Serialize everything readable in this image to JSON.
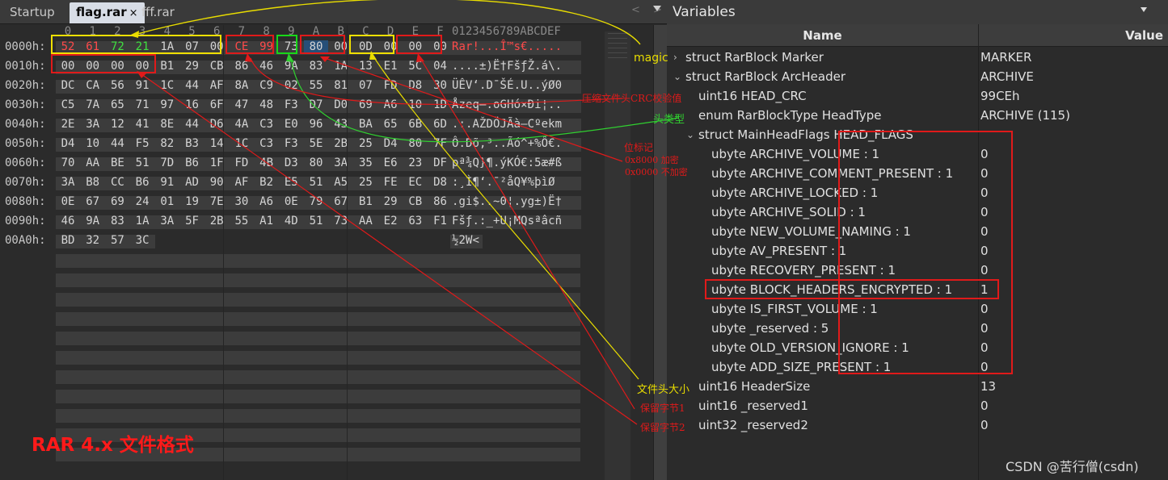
{
  "tabs": [
    {
      "label": "Startup"
    },
    {
      "label": "flag.rar",
      "close": "×"
    },
    {
      "label": "fff.rar"
    }
  ],
  "tab_nav": "< >",
  "hex": {
    "col_headers": [
      "0",
      "1",
      "2",
      "3",
      "4",
      "5",
      "6",
      "7",
      "8",
      "9",
      "A",
      "B",
      "C",
      "D",
      "E",
      "F"
    ],
    "ascii_header": "0123456789ABCDEF",
    "rows": [
      {
        "offset": "0000h:",
        "bytes": [
          "52",
          "61",
          "72",
          "21",
          "1A",
          "07",
          "00",
          "CE",
          "99",
          "73",
          "80",
          "00",
          "0D",
          "00",
          "00",
          "00"
        ],
        "ascii": "Rar!...Î™s€....."
      },
      {
        "offset": "0010h:",
        "bytes": [
          "00",
          "00",
          "00",
          "00",
          "B1",
          "29",
          "CB",
          "86",
          "46",
          "9A",
          "83",
          "1A",
          "13",
          "E1",
          "5C",
          "04"
        ],
        "ascii": "....±)Ë†FšƒŽ.á\\."
      },
      {
        "offset": "0020h:",
        "bytes": [
          "DC",
          "CA",
          "56",
          "91",
          "1C",
          "44",
          "AF",
          "8A",
          "C9",
          "02",
          "55",
          "81",
          "07",
          "FD",
          "D8",
          "30"
        ],
        "ascii": "ÜÊV‘.D¯ŠÉ.U..ýØ0"
      },
      {
        "offset": "0030h:",
        "bytes": [
          "C5",
          "7A",
          "65",
          "71",
          "97",
          "16",
          "6F",
          "47",
          "48",
          "F3",
          "D7",
          "D0",
          "69",
          "A6",
          "10",
          "1D"
        ],
        "ascii": "Åzeq—.oGHó×Ði¦.."
      },
      {
        "offset": "0040h:",
        "bytes": [
          "2E",
          "3A",
          "12",
          "41",
          "8E",
          "44",
          "D6",
          "4A",
          "C3",
          "E0",
          "96",
          "43",
          "BA",
          "65",
          "6B",
          "6D"
        ],
        "ascii": ".:.AŽDÖJÃà–Cºekm"
      },
      {
        "offset": "0050h:",
        "bytes": [
          "D4",
          "10",
          "44",
          "F5",
          "82",
          "B3",
          "14",
          "1C",
          "C3",
          "F3",
          "5E",
          "2B",
          "25",
          "D4",
          "80",
          "7F"
        ],
        "ascii": "Ô.Dõ‚³..Ãó^+%Ô€."
      },
      {
        "offset": "0060h:",
        "bytes": [
          "70",
          "AA",
          "BE",
          "51",
          "7D",
          "B6",
          "1F",
          "FD",
          "4B",
          "D3",
          "80",
          "3A",
          "35",
          "E6",
          "23",
          "DF"
        ],
        "ascii": "pª¾Q}¶.ýKÓ€:5æ#ß"
      },
      {
        "offset": "0070h:",
        "bytes": [
          "3A",
          "B8",
          "CC",
          "B6",
          "91",
          "AD",
          "90",
          "AF",
          "B2",
          "E5",
          "51",
          "A5",
          "25",
          "FE",
          "EC",
          "D8"
        ],
        "ascii": ":¸Ì¶‘­.¯²åQ¥%þìØ"
      },
      {
        "offset": "0080h:",
        "bytes": [
          "0E",
          "67",
          "69",
          "24",
          "01",
          "19",
          "7E",
          "30",
          "A6",
          "0E",
          "79",
          "67",
          "B1",
          "29",
          "CB",
          "86"
        ],
        "ascii": ".gi$..~0¦.yg±)Ë†"
      },
      {
        "offset": "0090h:",
        "bytes": [
          "46",
          "9A",
          "83",
          "1A",
          "3A",
          "5F",
          "2B",
          "55",
          "A1",
          "4D",
          "51",
          "73",
          "AA",
          "E2",
          "63",
          "F1"
        ],
        "ascii": "Fšƒ.:_+U¡MQsªâcñ"
      },
      {
        "offset": "00A0h:",
        "bytes": [
          "BD",
          "32",
          "57",
          "3C"
        ],
        "ascii": "½2W<"
      }
    ]
  },
  "variables": {
    "title": "Variables",
    "col_name": "Name",
    "col_value": "Value",
    "rows": [
      {
        "name": "struct RarBlock Marker",
        "value": "MARKER",
        "twisty": "›"
      },
      {
        "name": "struct RarBlock ArcHeader",
        "value": "ARCHIVE",
        "twisty": "⌄"
      },
      {
        "name": "uint16 HEAD_CRC",
        "value": "99CEh"
      },
      {
        "name": "enum RarBlockType HeadType",
        "value": "ARCHIVE (115)"
      },
      {
        "name": "struct MainHeadFlags HEAD_FLAGS",
        "value": "",
        "twisty": "⌄"
      },
      {
        "name": "ubyte ARCHIVE_VOLUME : 1",
        "value": "0"
      },
      {
        "name": "ubyte ARCHIVE_COMMENT_PRESENT : 1",
        "value": "0"
      },
      {
        "name": "ubyte ARCHIVE_LOCKED : 1",
        "value": "0"
      },
      {
        "name": "ubyte ARCHIVE_SOLID : 1",
        "value": "0"
      },
      {
        "name": "ubyte NEW_VOLUME_NAMING : 1",
        "value": "0"
      },
      {
        "name": "ubyte AV_PRESENT : 1",
        "value": "0"
      },
      {
        "name": "ubyte RECOVERY_PRESENT : 1",
        "value": "0"
      },
      {
        "name": "ubyte BLOCK_HEADERS_ENCRYPTED : 1",
        "value": "1"
      },
      {
        "name": "ubyte IS_FIRST_VOLUME : 1",
        "value": "0"
      },
      {
        "name": "ubyte _reserved : 5",
        "value": "0"
      },
      {
        "name": "ubyte OLD_VERSION_IGNORE : 1",
        "value": "0"
      },
      {
        "name": "ubyte ADD_SIZE_PRESENT : 1",
        "value": "0"
      },
      {
        "name": "uint16 HeaderSize",
        "value": "13"
      },
      {
        "name": "uint16 _reserved1",
        "value": "0"
      },
      {
        "name": "uint32 _reserved2",
        "value": "0"
      }
    ]
  },
  "annotations": {
    "magic": "magic",
    "crc": "压缩文件头CRC校验值",
    "head_type": "头类型",
    "flags_title": "位标记",
    "flags_encrypted": "0x8000 加密",
    "flags_plain": "0x0000 不加密",
    "header_size": "文件头大小",
    "reserved1": "保留字节1",
    "reserved2": "保留字节2",
    "format_title": "RAR 4.x 文件格式",
    "watermark": "CSDN @苦行僧(csdn)"
  },
  "colors": {
    "yellow_box": "#f0e000",
    "red_box": "#e01a1a",
    "green_box": "#18d818",
    "annotation_red": "#e01a1a"
  }
}
